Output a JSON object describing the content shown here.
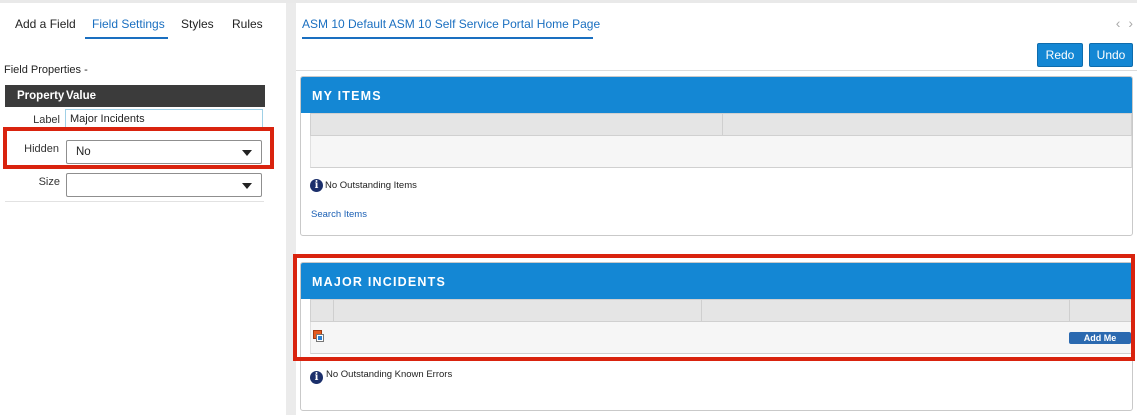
{
  "left_panel": {
    "tabs": [
      {
        "label": "Add a Field",
        "active": false
      },
      {
        "label": "Field Settings",
        "active": true
      },
      {
        "label": "Styles",
        "active": false
      },
      {
        "label": "Rules",
        "active": false
      }
    ],
    "section_title": "Field Properties -",
    "table_headers": {
      "property": "Property",
      "value": "Value"
    },
    "rows": {
      "label": {
        "name": "Label",
        "value": "Major Incidents"
      },
      "hidden": {
        "name": "Hidden",
        "value": "No"
      },
      "size": {
        "name": "Size",
        "value": ""
      }
    }
  },
  "right_panel": {
    "page_tab": "ASM 10 Default ASM 10 Self Service Portal Home Page",
    "nav": {
      "prev": "‹",
      "next": "›"
    },
    "buttons": {
      "redo": "Redo",
      "undo": "Undo"
    },
    "my_items": {
      "title": "MY ITEMS",
      "empty_message": "No Outstanding Items",
      "link": "Search Items"
    },
    "major_incidents": {
      "title": "MAJOR INCIDENTS",
      "add_button": "Add Me",
      "empty_message": "No Outstanding Known Errors"
    }
  },
  "colors": {
    "accent": "#1487d4",
    "highlight": "#d9230e",
    "header_dark": "#3b3b3b",
    "tab_active": "#1a6fc0"
  },
  "icons": {
    "info": "info-icon",
    "dropdown": "chevron-down-icon",
    "image": "image-icon"
  }
}
